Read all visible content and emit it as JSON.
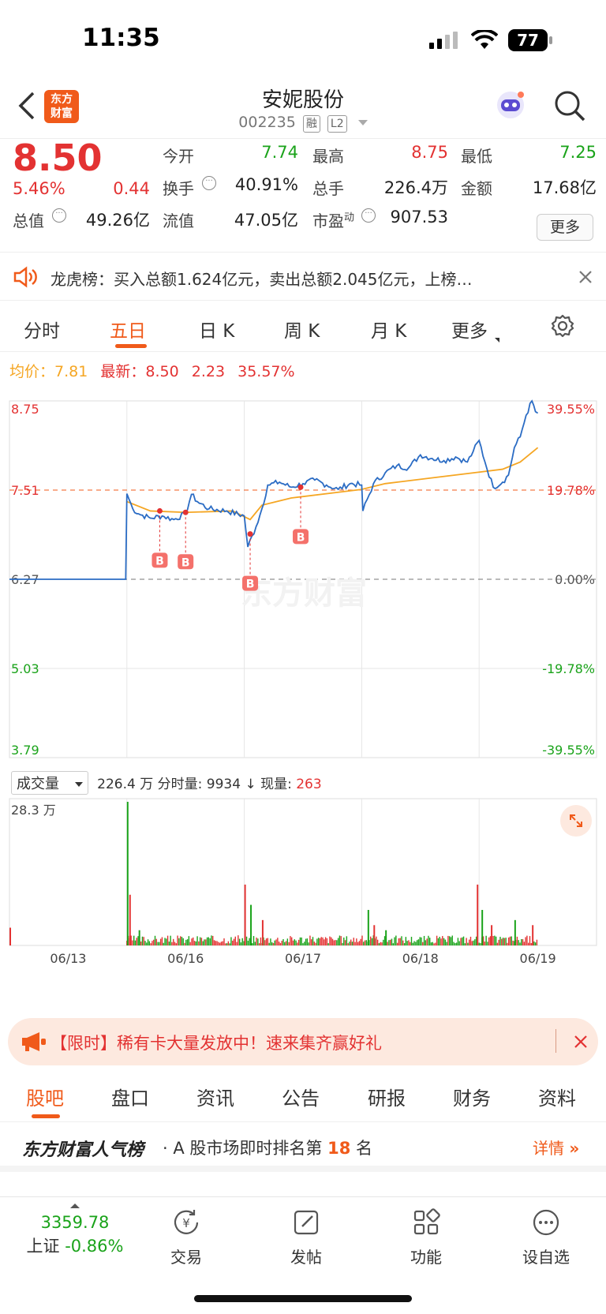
{
  "status": {
    "time": "11:35",
    "battery": "77"
  },
  "header": {
    "name": "安妮股份",
    "code": "002235",
    "tag_margin": "融",
    "tag_level": "L2",
    "logo_line1": "东方",
    "logo_line2": "财富"
  },
  "quote": {
    "price": "8.50",
    "change_pct": "5.46%",
    "change": "0.44",
    "open_label": "今开",
    "open": "7.74",
    "high_label": "最高",
    "high": "8.75",
    "low_label": "最低",
    "low": "7.25",
    "turnover_label": "换手",
    "turnover": "40.91%",
    "volume_label": "总手",
    "volume": "226.4万",
    "amount_label": "金额",
    "amount": "17.68亿",
    "mktcap_label": "总值",
    "mktcap": "49.26亿",
    "float_label": "流值",
    "float": "47.05亿",
    "pe_label": "市盈",
    "pe_sup": "动",
    "pe": "907.53",
    "more": "更多"
  },
  "notice": {
    "text": "龙虎榜：买入总额1.624亿元，卖出总额2.045亿元，上榜…"
  },
  "tabs": [
    "分时",
    "五日",
    "日 K",
    "周 K",
    "月 K",
    "更多"
  ],
  "active_tab": "五日",
  "chart_header": {
    "avg_label": "均价：",
    "avg": "7.81",
    "latest_label": "最新：",
    "latest": "8.50",
    "change": "2.23",
    "change_pct": "35.57%"
  },
  "volume_header": {
    "selector": "成交量",
    "total": "226.4 万",
    "period_label": "分时量:",
    "period": "9934",
    "current_label": "现量:",
    "current": "263",
    "arrow": "↓"
  },
  "chart_data": {
    "type": "line",
    "title": "",
    "series": [
      {
        "name": "",
        "kind": "price"
      },
      {
        "name": "",
        "kind": "average"
      }
    ],
    "days": [
      "06/13",
      "06/16",
      "06/17",
      "06/18",
      "06/19"
    ],
    "price_ticks": [
      "8.75",
      "7.51",
      "6.27",
      "5.03",
      "3.79"
    ],
    "pct_ticks": [
      "39.55%",
      "19.78%",
      "0.00%",
      "-19.78%",
      "-39.55%"
    ],
    "ylim": [
      3.79,
      8.75
    ],
    "prev_close": 6.27,
    "price_points": [
      [
        0,
        6.27
      ],
      [
        0.99,
        6.27
      ],
      [
        1.0,
        7.46
      ],
      [
        1.05,
        7.25
      ],
      [
        1.1,
        7.18
      ],
      [
        1.2,
        7.12
      ],
      [
        1.3,
        7.15
      ],
      [
        1.4,
        7.1
      ],
      [
        1.5,
        7.18
      ],
      [
        1.55,
        7.45
      ],
      [
        1.6,
        7.35
      ],
      [
        1.7,
        7.25
      ],
      [
        1.85,
        7.22
      ],
      [
        2.0,
        7.15
      ],
      [
        2.03,
        6.72
      ],
      [
        2.1,
        7.0
      ],
      [
        2.15,
        7.25
      ],
      [
        2.2,
        7.58
      ],
      [
        2.3,
        7.62
      ],
      [
        2.4,
        7.55
      ],
      [
        2.5,
        7.6
      ],
      [
        2.6,
        7.65
      ],
      [
        2.7,
        7.58
      ],
      [
        2.8,
        7.52
      ],
      [
        2.9,
        7.6
      ],
      [
        3.0,
        7.58
      ],
      [
        3.01,
        7.22
      ],
      [
        3.1,
        7.6
      ],
      [
        3.2,
        7.75
      ],
      [
        3.3,
        7.85
      ],
      [
        3.4,
        7.82
      ],
      [
        3.5,
        8.0
      ],
      [
        3.6,
        7.95
      ],
      [
        3.7,
        7.92
      ],
      [
        3.8,
        7.97
      ],
      [
        3.9,
        7.9
      ],
      [
        3.95,
        8.05
      ],
      [
        4.0,
        8.2
      ],
      [
        4.05,
        7.9
      ],
      [
        4.12,
        7.55
      ],
      [
        4.2,
        7.62
      ],
      [
        4.25,
        7.72
      ],
      [
        4.3,
        8.1
      ],
      [
        4.35,
        8.25
      ],
      [
        4.4,
        8.55
      ],
      [
        4.45,
        8.75
      ],
      [
        4.48,
        8.6
      ],
      [
        4.5,
        8.58
      ]
    ],
    "avg_points": [
      [
        1.0,
        7.35
      ],
      [
        1.2,
        7.22
      ],
      [
        1.5,
        7.2
      ],
      [
        1.9,
        7.22
      ],
      [
        2.05,
        7.1
      ],
      [
        2.15,
        7.3
      ],
      [
        2.4,
        7.4
      ],
      [
        2.8,
        7.48
      ],
      [
        3.0,
        7.52
      ],
      [
        3.2,
        7.6
      ],
      [
        3.6,
        7.68
      ],
      [
        4.0,
        7.76
      ],
      [
        4.2,
        7.8
      ],
      [
        4.35,
        7.9
      ],
      [
        4.5,
        8.1
      ]
    ],
    "buy_markers": [
      {
        "label": "B",
        "x": 1.28,
        "y": 7.22
      },
      {
        "label": "B",
        "x": 1.5,
        "y": 7.2
      },
      {
        "label": "B",
        "x": 2.05,
        "y": 6.9
      },
      {
        "label": "B",
        "x": 2.48,
        "y": 7.55
      }
    ],
    "volume_max_label": "28.3 万",
    "volume_spikes": [
      {
        "x": 0.0,
        "v": 3.5
      },
      {
        "x": 1.0,
        "v": 28.3
      },
      {
        "x": 1.02,
        "v": 10
      },
      {
        "x": 1.1,
        "v": 3
      },
      {
        "x": 2.0,
        "v": 12
      },
      {
        "x": 2.05,
        "v": 8
      },
      {
        "x": 2.15,
        "v": 5
      },
      {
        "x": 3.05,
        "v": 7
      },
      {
        "x": 3.1,
        "v": 4
      },
      {
        "x": 3.2,
        "v": 3
      },
      {
        "x": 3.98,
        "v": 12
      },
      {
        "x": 4.02,
        "v": 7
      },
      {
        "x": 4.1,
        "v": 4
      },
      {
        "x": 4.3,
        "v": 5
      },
      {
        "x": 4.45,
        "v": 4
      }
    ]
  },
  "promo": {
    "text": "【限时】稀有卡大量发放中！速来集齐赢好礼"
  },
  "subtabs": [
    "股吧",
    "盘口",
    "资讯",
    "公告",
    "研报",
    "财务",
    "资料"
  ],
  "popular": {
    "brand": "东方财富人气榜",
    "dot": "·",
    "text_a": "A 股市场即时排名第",
    "rank": "18",
    "text_b": "名",
    "detail": "详情"
  },
  "bottom": {
    "index_value": "3359.78",
    "index_name": "上证",
    "index_change": "-0.86%",
    "items": [
      "交易",
      "发帖",
      "功能",
      "设自选"
    ]
  },
  "colors": {
    "up": "#e33232",
    "down": "#1aa31a",
    "accent": "#f05a1a",
    "price_line": "#2b6cc4",
    "avg_line": "#f5a623"
  }
}
